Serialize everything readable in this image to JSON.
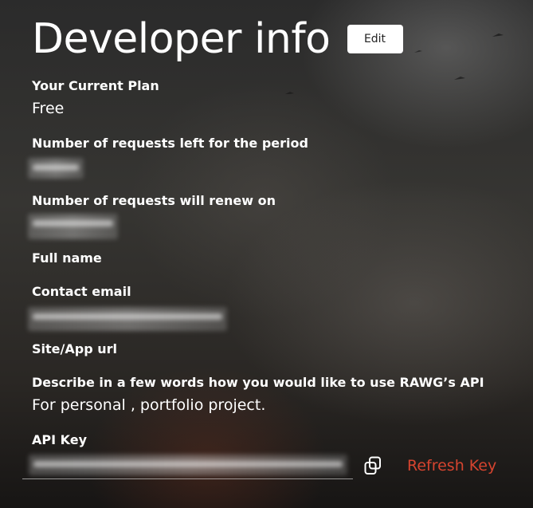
{
  "header": {
    "title": "Developer info",
    "edit_label": "Edit"
  },
  "fields": {
    "plan": {
      "label": "Your Current Plan",
      "value": "Free"
    },
    "requests_left": {
      "label": "Number of requests left for the period"
    },
    "renew_on": {
      "label": "Number of requests will renew on"
    },
    "full_name": {
      "label": "Full name"
    },
    "contact_email": {
      "label": "Contact email"
    },
    "site_url": {
      "label": "Site/App url"
    },
    "usage": {
      "label": "Describe in a few words how you would like to use RAWG’s API",
      "value": "For personal , portfolio project."
    },
    "api_key": {
      "label": "API Key",
      "refresh_label": "Refresh Key"
    }
  },
  "icons": {
    "copy": "copy-icon"
  },
  "colors": {
    "accent": "#d6442f",
    "text": "#ffffff",
    "button_bg": "#ffffff"
  }
}
